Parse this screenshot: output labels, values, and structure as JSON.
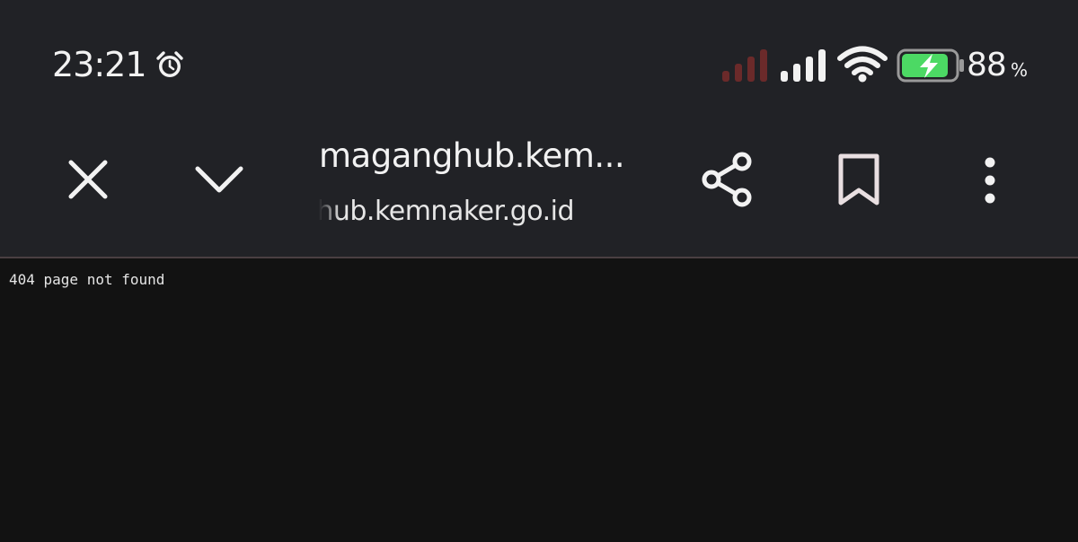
{
  "status_bar": {
    "time": "23:21",
    "battery_level": "88",
    "battery_unit": "%",
    "battery_percent_value": 88,
    "battery_color": "#4cd964",
    "icons": [
      "alarm-icon",
      "signal-sim1-icon",
      "signal-sim2-icon",
      "wifi-icon",
      "battery-charging-icon"
    ]
  },
  "toolbar": {
    "page_title": "maganghub.kem...",
    "url": "maganghub.kemnaker.go.id",
    "icons": [
      "close-icon",
      "chevron-down-icon",
      "share-icon",
      "bookmark-icon",
      "more-vert-icon"
    ]
  },
  "content": {
    "message": "404 page not found"
  },
  "colors": {
    "toolbar_bg": "#212226",
    "page_bg": "#121212",
    "text": "#f2f2f2",
    "inactive_signal": "#6b2a2a"
  }
}
